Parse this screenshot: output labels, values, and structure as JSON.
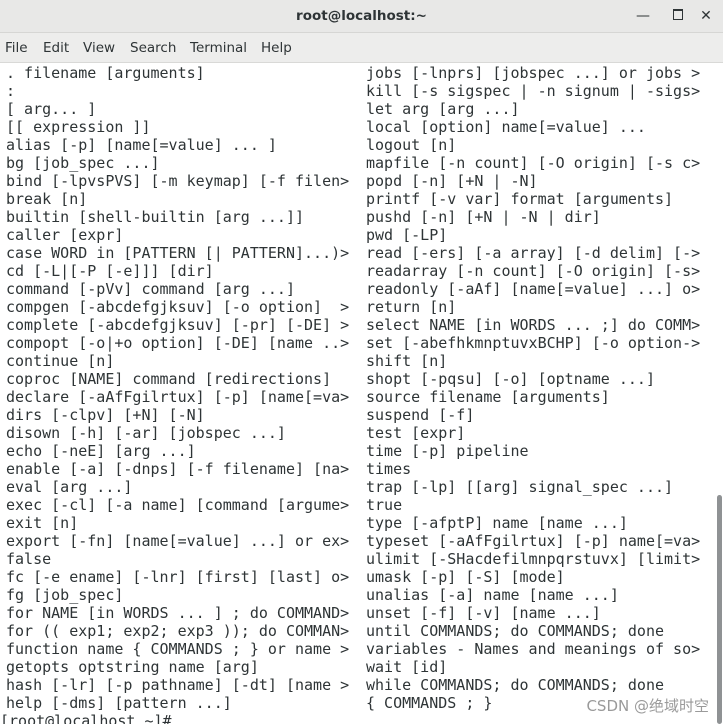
{
  "window": {
    "title": "root@localhost:~",
    "buttons": {
      "minimize_glyph": "—",
      "maximize_glyph": "",
      "close_glyph": "✕"
    }
  },
  "menubar": {
    "items": [
      "File",
      "Edit",
      "View",
      "Search",
      "Terminal",
      "Help"
    ]
  },
  "terminal": {
    "left_column": [
      ". filename [arguments]",
      ":",
      "[ arg... ]",
      "[[ expression ]]",
      "alias [-p] [name[=value] ... ]",
      "bg [job_spec ...]",
      "bind [-lpvsPVS] [-m keymap] [-f filen>",
      "break [n]",
      "builtin [shell-builtin [arg ...]]",
      "caller [expr]",
      "case WORD in [PATTERN [| PATTERN]...)>",
      "cd [-L|[-P [-e]]] [dir]",
      "command [-pVv] command [arg ...]",
      "compgen [-abcdefgjksuv] [-o option]  >",
      "complete [-abcdefgjksuv] [-pr] [-DE] >",
      "compopt [-o|+o option] [-DE] [name ..>",
      "continue [n]",
      "coproc [NAME] command [redirections]",
      "declare [-aAfFgilrtux] [-p] [name[=va>",
      "dirs [-clpv] [+N] [-N]",
      "disown [-h] [-ar] [jobspec ...]",
      "echo [-neE] [arg ...]",
      "enable [-a] [-dnps] [-f filename] [na>",
      "eval [arg ...]",
      "exec [-cl] [-a name] [command [argume>",
      "exit [n]",
      "export [-fn] [name[=value] ...] or ex>",
      "false",
      "fc [-e ename] [-lnr] [first] [last] o>",
      "fg [job_spec]",
      "for NAME [in WORDS ... ] ; do COMMAND>",
      "for (( exp1; exp2; exp3 )); do COMMAN>",
      "function name { COMMANDS ; } or name >",
      "getopts optstring name [arg]",
      "hash [-lr] [-p pathname] [-dt] [name >",
      "help [-dms] [pattern ...]"
    ],
    "right_column": [
      "jobs [-lnprs] [jobspec ...] or jobs >",
      "kill [-s sigspec | -n signum | -sigs>",
      "let arg [arg ...]",
      "local [option] name[=value] ...",
      "logout [n]",
      "mapfile [-n count] [-O origin] [-s c>",
      "popd [-n] [+N | -N]",
      "printf [-v var] format [arguments]",
      "pushd [-n] [+N | -N | dir]",
      "pwd [-LP]",
      "read [-ers] [-a array] [-d delim] [->",
      "readarray [-n count] [-O origin] [-s>",
      "readonly [-aAf] [name[=value] ...] o>",
      "return [n]",
      "select NAME [in WORDS ... ;] do COMM>",
      "set [-abefhkmnptuvxBCHP] [-o option->",
      "shift [n]",
      "shopt [-pqsu] [-o] [optname ...]",
      "source filename [arguments]",
      "suspend [-f]",
      "test [expr]",
      "time [-p] pipeline",
      "times",
      "trap [-lp] [[arg] signal_spec ...]",
      "true",
      "type [-afptP] name [name ...]",
      "typeset [-aAfFgilrtux] [-p] name[=va>",
      "ulimit [-SHacdefilmnpqrstuvx] [limit>",
      "umask [-p] [-S] [mode]",
      "unalias [-a] name [name ...]",
      "unset [-f] [-v] [name ...]",
      "until COMMANDS; do COMMANDS; done",
      "variables - Names and meanings of so>",
      "wait [id]",
      "while COMMANDS; do COMMANDS; done",
      "{ COMMANDS ; }"
    ],
    "prompt": "[root@localhost ~]#"
  },
  "watermark": "CSDN @绝域时空"
}
